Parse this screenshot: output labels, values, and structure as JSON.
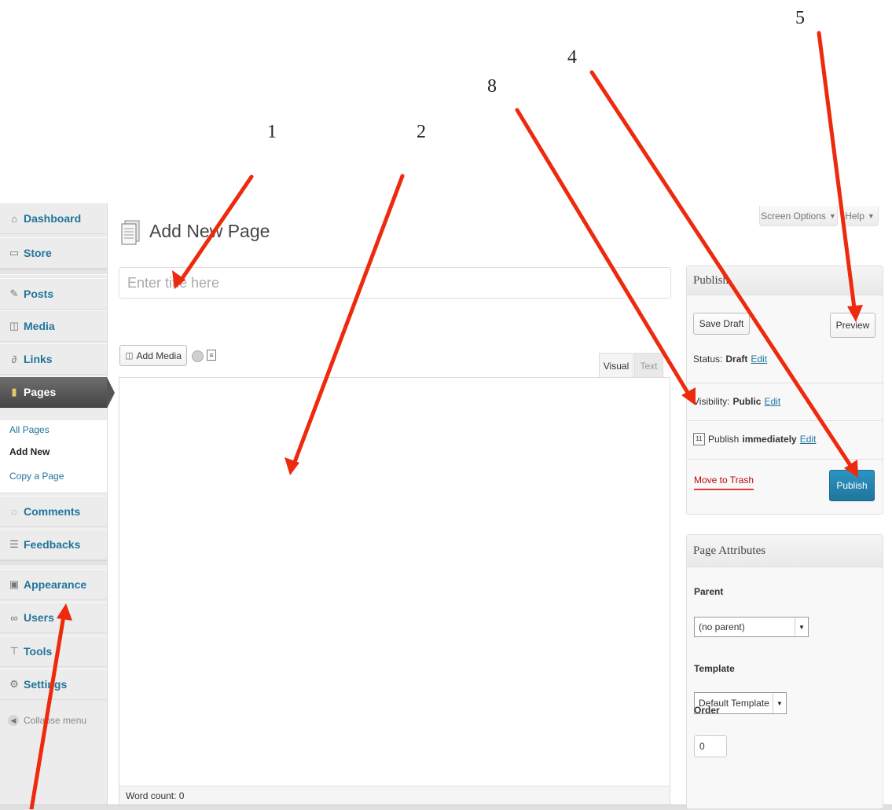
{
  "annotations": [
    "1",
    "2",
    "8",
    "4",
    "5"
  ],
  "admin_menu": {
    "items": [
      {
        "label": "Dashboard",
        "icon": "house-icon"
      },
      {
        "label": "Store",
        "icon": "cart-icon"
      },
      {
        "label": "Posts",
        "icon": "pin-icon"
      },
      {
        "label": "Media",
        "icon": "camera-icon"
      },
      {
        "label": "Links",
        "icon": "link-icon"
      },
      {
        "label": "Pages",
        "icon": "pages-icon"
      },
      {
        "label": "Comments",
        "icon": "comment-icon"
      },
      {
        "label": "Feedbacks",
        "icon": "feedback-icon"
      },
      {
        "label": "Appearance",
        "icon": "appearance-icon"
      },
      {
        "label": "Users",
        "icon": "users-icon"
      },
      {
        "label": "Tools",
        "icon": "tools-icon"
      },
      {
        "label": "Settings",
        "icon": "settings-icon"
      }
    ],
    "submenu": [
      "All Pages",
      "Add New",
      "Copy a Page"
    ],
    "collapse_label": "Collapse menu"
  },
  "header": {
    "title": "Add New Page",
    "screen_options": "Screen Options",
    "help": "Help"
  },
  "title_field": {
    "placeholder": "Enter title here",
    "value": ""
  },
  "editor": {
    "add_media": "Add Media",
    "tab_visual": "Visual",
    "tab_text": "Text",
    "word_count": "Word count: 0"
  },
  "publish": {
    "heading": "Publish",
    "save_draft": "Save Draft",
    "preview": "Preview",
    "status_label": "Status:",
    "status_value": "Draft",
    "visibility_label": "Visibility:",
    "visibility_value": "Public",
    "publish_label": "Publish",
    "publish_value": "immediately",
    "edit": "Edit",
    "move_to_trash": "Move to Trash",
    "publish_button": "Publish"
  },
  "page_attributes": {
    "heading": "Page Attributes",
    "parent_label": "Parent",
    "parent_value": "(no parent)",
    "template_label": "Template",
    "template_value": "Default Template",
    "order_label": "Order",
    "order_value": "0"
  },
  "colors": {
    "arrow": "#ee2a0e",
    "link": "#21759b",
    "publish_button": "#21759b",
    "trash": "#bc0b0b"
  }
}
